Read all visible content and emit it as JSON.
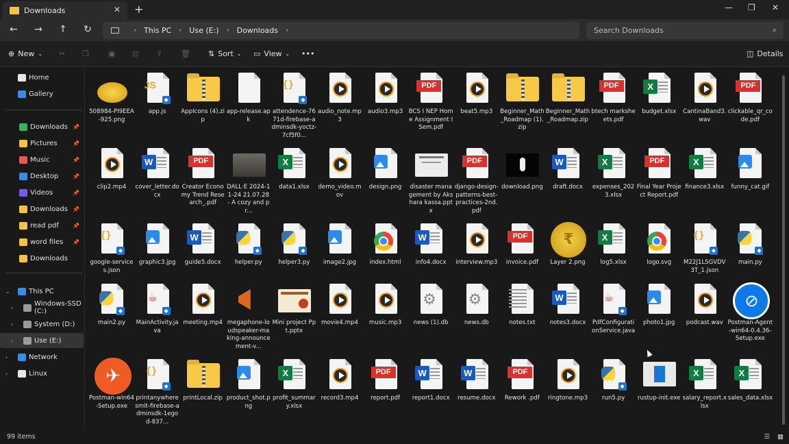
{
  "window": {
    "tab_title": "Downloads"
  },
  "address": {
    "segments": [
      "This PC",
      "Use (E:)",
      "Downloads"
    ]
  },
  "search": {
    "placeholder": "Search Downloads"
  },
  "toolbar": {
    "new_label": "New",
    "sort_label": "Sort",
    "view_label": "View",
    "details_label": "Details"
  },
  "sidebar": {
    "items": [
      {
        "label": "Home",
        "icon": "home"
      },
      {
        "label": "Gallery",
        "icon": "gallery"
      },
      {
        "label": "Downloads",
        "icon": "download",
        "pinned": true
      },
      {
        "label": "Pictures",
        "icon": "folder",
        "pinned": true
      },
      {
        "label": "Music",
        "icon": "music",
        "pinned": true
      },
      {
        "label": "Desktop",
        "icon": "desktop",
        "pinned": true
      },
      {
        "label": "Videos",
        "icon": "video",
        "pinned": true
      },
      {
        "label": "Downloads",
        "icon": "folder",
        "pinned": true
      },
      {
        "label": "read pdf",
        "icon": "folder",
        "pinned": true
      },
      {
        "label": "word files",
        "icon": "folder",
        "pinned": true
      },
      {
        "label": "Downloads",
        "icon": "folder",
        "pinned": false
      },
      {
        "label": "This PC",
        "icon": "pc"
      },
      {
        "label": "Windows-SSD (C:)",
        "icon": "drive"
      },
      {
        "label": "System (D:)",
        "icon": "drive"
      },
      {
        "label": "Use (E:)",
        "icon": "drive",
        "selected": true
      },
      {
        "label": "Network",
        "icon": "network"
      },
      {
        "label": "Linux",
        "icon": "linux"
      }
    ]
  },
  "files": [
    {
      "name": "508984-PI9EEA-925.png",
      "type": "coins"
    },
    {
      "name": "app.js",
      "type": "js"
    },
    {
      "name": "AppIcons (4).zip",
      "type": "zip"
    },
    {
      "name": "app-release.apk",
      "type": "blank"
    },
    {
      "name": "attendence-7671d-firebase-adminsdk-yoctz-7cf5f0...",
      "type": "json"
    },
    {
      "name": "audio_note.mp3",
      "type": "media"
    },
    {
      "name": "audio3.mp3",
      "type": "media"
    },
    {
      "name": "BCS I NEP Home Assignment I Sem.pdf",
      "type": "pdf"
    },
    {
      "name": "beat5.mp3",
      "type": "media"
    },
    {
      "name": "Beginner_Math_Roadmap (1).zip",
      "type": "zip"
    },
    {
      "name": "Beginner_Math_Roadmap.zip",
      "type": "zip"
    },
    {
      "name": "btech marksheets.pdf",
      "type": "pdf"
    },
    {
      "name": "budget.xlsx",
      "type": "xlsx"
    },
    {
      "name": "CantinaBand3.wav",
      "type": "media"
    },
    {
      "name": "clickable_qr_code.pdf",
      "type": "pdf"
    },
    {
      "name": "clip2.mp4",
      "type": "media"
    },
    {
      "name": "cover_letter.docx",
      "type": "docx"
    },
    {
      "name": "Creator Economy Trend Research_.pdf",
      "type": "pdf"
    },
    {
      "name": "DALL·E 2024-11-24 21.07.28 - A cozy and pr...",
      "type": "photo"
    },
    {
      "name": "data1.xlsx",
      "type": "xlsx"
    },
    {
      "name": "demo_video.mov",
      "type": "media"
    },
    {
      "name": "design.png",
      "type": "img"
    },
    {
      "name": "disaster management by Akshara kassa.pptx",
      "type": "slide"
    },
    {
      "name": "django-design-patterns-best-practices-2nd.pdf",
      "type": "pdf"
    },
    {
      "name": "download.png",
      "type": "dark"
    },
    {
      "name": "draft.docx",
      "type": "docx"
    },
    {
      "name": "expenses_2023.xlsx",
      "type": "xlsx"
    },
    {
      "name": "Final Year Project Report.pdf",
      "type": "pdf"
    },
    {
      "name": "finance3.xlsx",
      "type": "xlsx"
    },
    {
      "name": "funny_cat.gif",
      "type": "img"
    },
    {
      "name": "google-services.json",
      "type": "json"
    },
    {
      "name": "graphic3.jpg",
      "type": "img"
    },
    {
      "name": "guide5.docx",
      "type": "docx"
    },
    {
      "name": "helper.py",
      "type": "py"
    },
    {
      "name": "helper3.py",
      "type": "py"
    },
    {
      "name": "image2.jpg",
      "type": "img"
    },
    {
      "name": "index.html",
      "type": "chrome"
    },
    {
      "name": "info4.docx",
      "type": "docx"
    },
    {
      "name": "interview.mp3",
      "type": "media"
    },
    {
      "name": "invoice.pdf",
      "type": "pdf"
    },
    {
      "name": "Layer 2.png",
      "type": "coin"
    },
    {
      "name": "log5.xlsx",
      "type": "xlsx"
    },
    {
      "name": "logo.svg",
      "type": "chrome"
    },
    {
      "name": "M22J1LSGVDV3T_1.json",
      "type": "json"
    },
    {
      "name": "main.py",
      "type": "py"
    },
    {
      "name": "main2.py",
      "type": "py"
    },
    {
      "name": "MainActivity.java",
      "type": "java"
    },
    {
      "name": "meeting.mp4",
      "type": "media"
    },
    {
      "name": "megaphone-loudspeaker-making-announcement-v...",
      "type": "megaphone"
    },
    {
      "name": "Mini project Ppt.pptx",
      "type": "slide2"
    },
    {
      "name": "movie4.mp4",
      "type": "media"
    },
    {
      "name": "music.mp3",
      "type": "media"
    },
    {
      "name": "news (1).db",
      "type": "gear"
    },
    {
      "name": "news.db",
      "type": "gear"
    },
    {
      "name": "notes.txt",
      "type": "txt"
    },
    {
      "name": "notes3.docx",
      "type": "docx"
    },
    {
      "name": "PdfConfigurationService.java",
      "type": "java"
    },
    {
      "name": "photo1.jpg",
      "type": "img"
    },
    {
      "name": "podcast.wav",
      "type": "media"
    },
    {
      "name": "Postman-Agent-win64-0.4.36-Setup.exe",
      "type": "postagent"
    },
    {
      "name": "Postman-win64-Setup.exe",
      "type": "postman"
    },
    {
      "name": "printanywheresmit-firebase-adminsdk-1egod-837...",
      "type": "json"
    },
    {
      "name": "printLocal.zip",
      "type": "zip"
    },
    {
      "name": "product_shot.png",
      "type": "img"
    },
    {
      "name": "profit_summary.xlsx",
      "type": "xlsx"
    },
    {
      "name": "record3.mp4",
      "type": "media"
    },
    {
      "name": "report.pdf",
      "type": "pdf"
    },
    {
      "name": "report1.docx",
      "type": "docx"
    },
    {
      "name": "resume.docx",
      "type": "docx"
    },
    {
      "name": "Rework .pdf",
      "type": "pdf"
    },
    {
      "name": "ringtone.mp3",
      "type": "media"
    },
    {
      "name": "run5.py",
      "type": "py"
    },
    {
      "name": "rustup-init.exe",
      "type": "exe"
    },
    {
      "name": "salary_report.xlsx",
      "type": "xlsx"
    },
    {
      "name": "sales_data.xlsx",
      "type": "xlsx"
    }
  ],
  "status": {
    "count": "99 items"
  },
  "colors": {
    "accent": "#0078d4",
    "folder": "#f7c948",
    "pdf": "#d9322c",
    "excel": "#107c41",
    "word": "#185abd"
  }
}
